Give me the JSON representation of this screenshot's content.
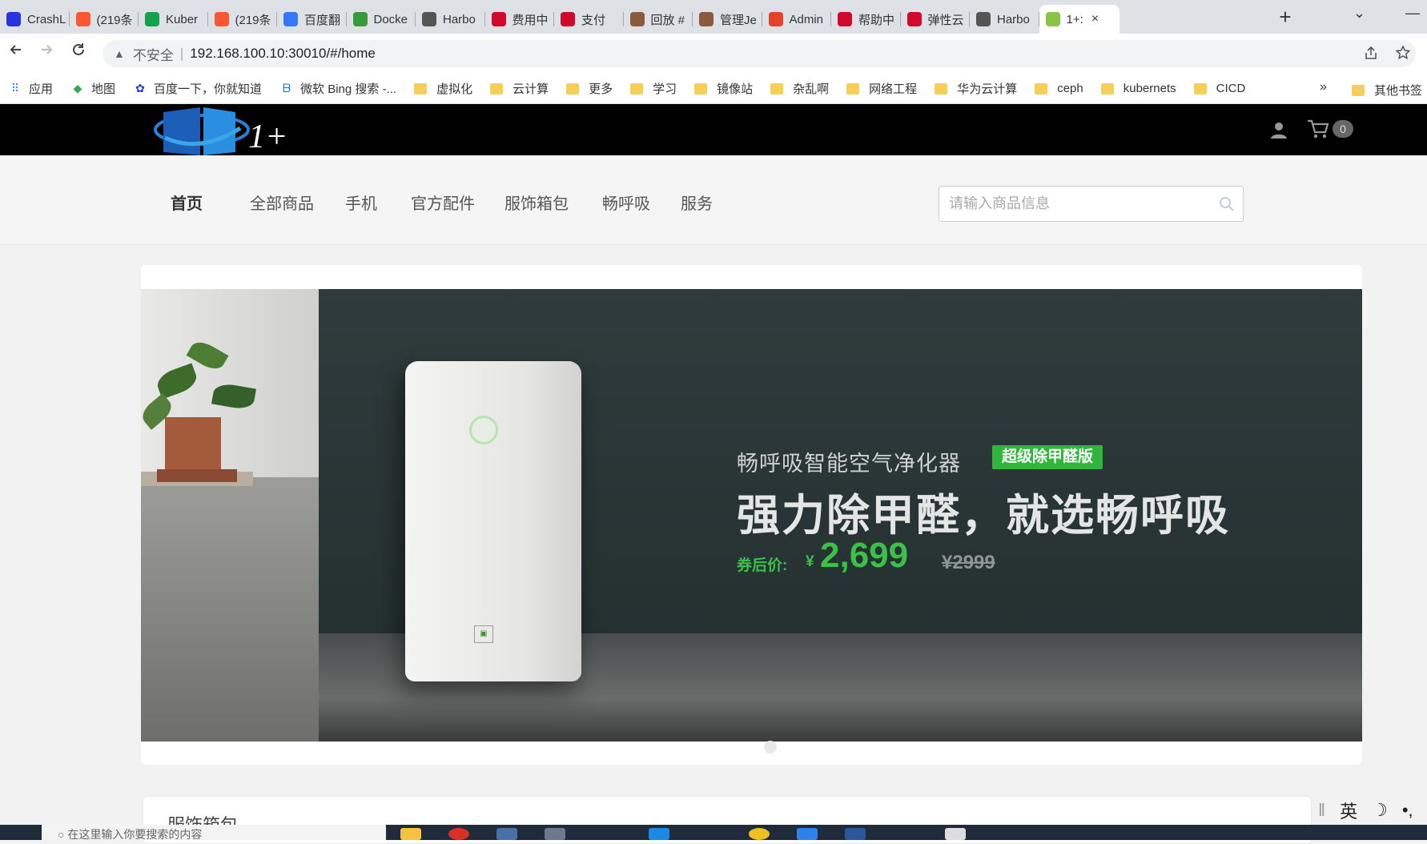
{
  "browser": {
    "tabs": [
      {
        "label": "CrashL",
        "icon": "baidu-paw-icon",
        "color": "#2932e1"
      },
      {
        "label": "(219条",
        "icon": "csdn-icon",
        "color": "#fc5531"
      },
      {
        "label": "Kuber",
        "icon": "t-icon",
        "color": "#15a34a"
      },
      {
        "label": "(219条",
        "icon": "csdn-icon",
        "color": "#fc5531"
      },
      {
        "label": "百度翻",
        "icon": "translate-icon",
        "color": "#3478f6"
      },
      {
        "label": "Docke",
        "icon": "leaf-icon",
        "color": "#3a9b3a"
      },
      {
        "label": "Harbo",
        "icon": "harbor-icon",
        "color": "#555555"
      },
      {
        "label": "费用中",
        "icon": "huawei-icon",
        "color": "#cf0a2c"
      },
      {
        "label": "支付",
        "icon": "huawei-icon",
        "color": "#cf0a2c"
      },
      {
        "label": "回放 #",
        "icon": "jenkins-icon",
        "color": "#8b5a3c"
      },
      {
        "label": "管理Je",
        "icon": "jenkins-icon",
        "color": "#8b5a3c"
      },
      {
        "label": "Admin",
        "icon": "gitlab-icon",
        "color": "#e24329"
      },
      {
        "label": "帮助中",
        "icon": "huawei-icon",
        "color": "#cf0a2c"
      },
      {
        "label": "弹性云",
        "icon": "huawei-icon",
        "color": "#cf0a2c"
      },
      {
        "label": "Harbo",
        "icon": "harbor-icon",
        "color": "#555555"
      },
      {
        "label": "1+:",
        "icon": "leaf-icon",
        "color": "#8bc34a"
      }
    ],
    "new_tab": "+",
    "minimize": "—",
    "tab_list": "⌄",
    "close_tab": "×",
    "address": {
      "insecure_label": "不安全",
      "url": "192.168.100.10:30010/#/home"
    },
    "bookmarks": [
      {
        "label": "应用",
        "kind": "apps"
      },
      {
        "label": "地图",
        "kind": "maps"
      },
      {
        "label": "百度一下，你就知道",
        "kind": "baidu"
      },
      {
        "label": "微软 Bing 搜索 -...",
        "kind": "bing"
      },
      {
        "label": "虚拟化",
        "kind": "folder"
      },
      {
        "label": "云计算",
        "kind": "folder"
      },
      {
        "label": "更多",
        "kind": "folder"
      },
      {
        "label": "学习",
        "kind": "folder"
      },
      {
        "label": "镜像站",
        "kind": "folder"
      },
      {
        "label": "杂乱啊",
        "kind": "folder"
      },
      {
        "label": "网络工程",
        "kind": "folder"
      },
      {
        "label": "华为云计算",
        "kind": "folder"
      },
      {
        "label": "ceph",
        "kind": "folder"
      },
      {
        "label": "kubernets",
        "kind": "folder"
      },
      {
        "label": "CICD",
        "kind": "folder"
      }
    ],
    "bookmarks_overflow": "»",
    "other_bookmarks": "其他书签"
  },
  "site": {
    "logo_text": "1+",
    "cart_count": "0",
    "nav": [
      {
        "label": "首页",
        "active": true
      },
      {
        "label": "全部商品"
      },
      {
        "label": "手机"
      },
      {
        "label": "官方配件"
      },
      {
        "label": "服饰箱包"
      },
      {
        "label": "畅呼吸"
      },
      {
        "label": "服务"
      }
    ],
    "search_placeholder": "请输入商品信息",
    "banner": {
      "subtitle": "畅呼吸智能空气净化器",
      "tag": "超级除甲醛版",
      "title": "强力除甲醛，就选畅呼吸",
      "price_label": "券后价:",
      "currency": "¥",
      "price": "2,699",
      "old_price": "¥2999"
    },
    "next_section_title": "服饰箱包"
  },
  "taskbar": {
    "search_text": "在这里输入你要搜索的内容",
    "ime_lang": "英",
    "ime_moon": "☽",
    "ime_dot": "•,"
  }
}
